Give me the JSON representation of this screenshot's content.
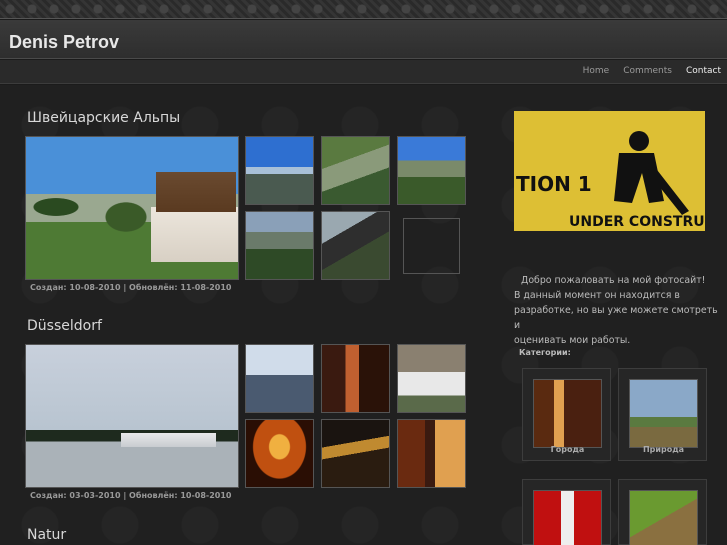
{
  "site": {
    "title": "Denis Petrov"
  },
  "nav": {
    "home": "Home",
    "comments": "Comments",
    "contact": "Contact"
  },
  "albums": [
    {
      "title": "Швейцарские Альпы",
      "dates": "Создан: 10-08-2010 | Обновлён: 11-08-2010"
    },
    {
      "title": "Düsseldorf",
      "dates": "Создан: 03-03-2010 | Обновлён: 10-08-2010"
    },
    {
      "title": "Natur"
    }
  ],
  "sidebar": {
    "welcome_line1": "Добро пожаловать на мой фотосайт!",
    "welcome_line2": "В данный момент он находится в",
    "welcome_line3": "разработке, но вы уже можете смотреть и",
    "welcome_line4": "оценивать мои работы.",
    "categories_title": "Категории:",
    "categories": [
      {
        "label": "Города"
      },
      {
        "label": "Природа"
      }
    ],
    "under_construction_text_1": "TION 1",
    "under_construction_text_2": "UNDER CONSTRU"
  }
}
